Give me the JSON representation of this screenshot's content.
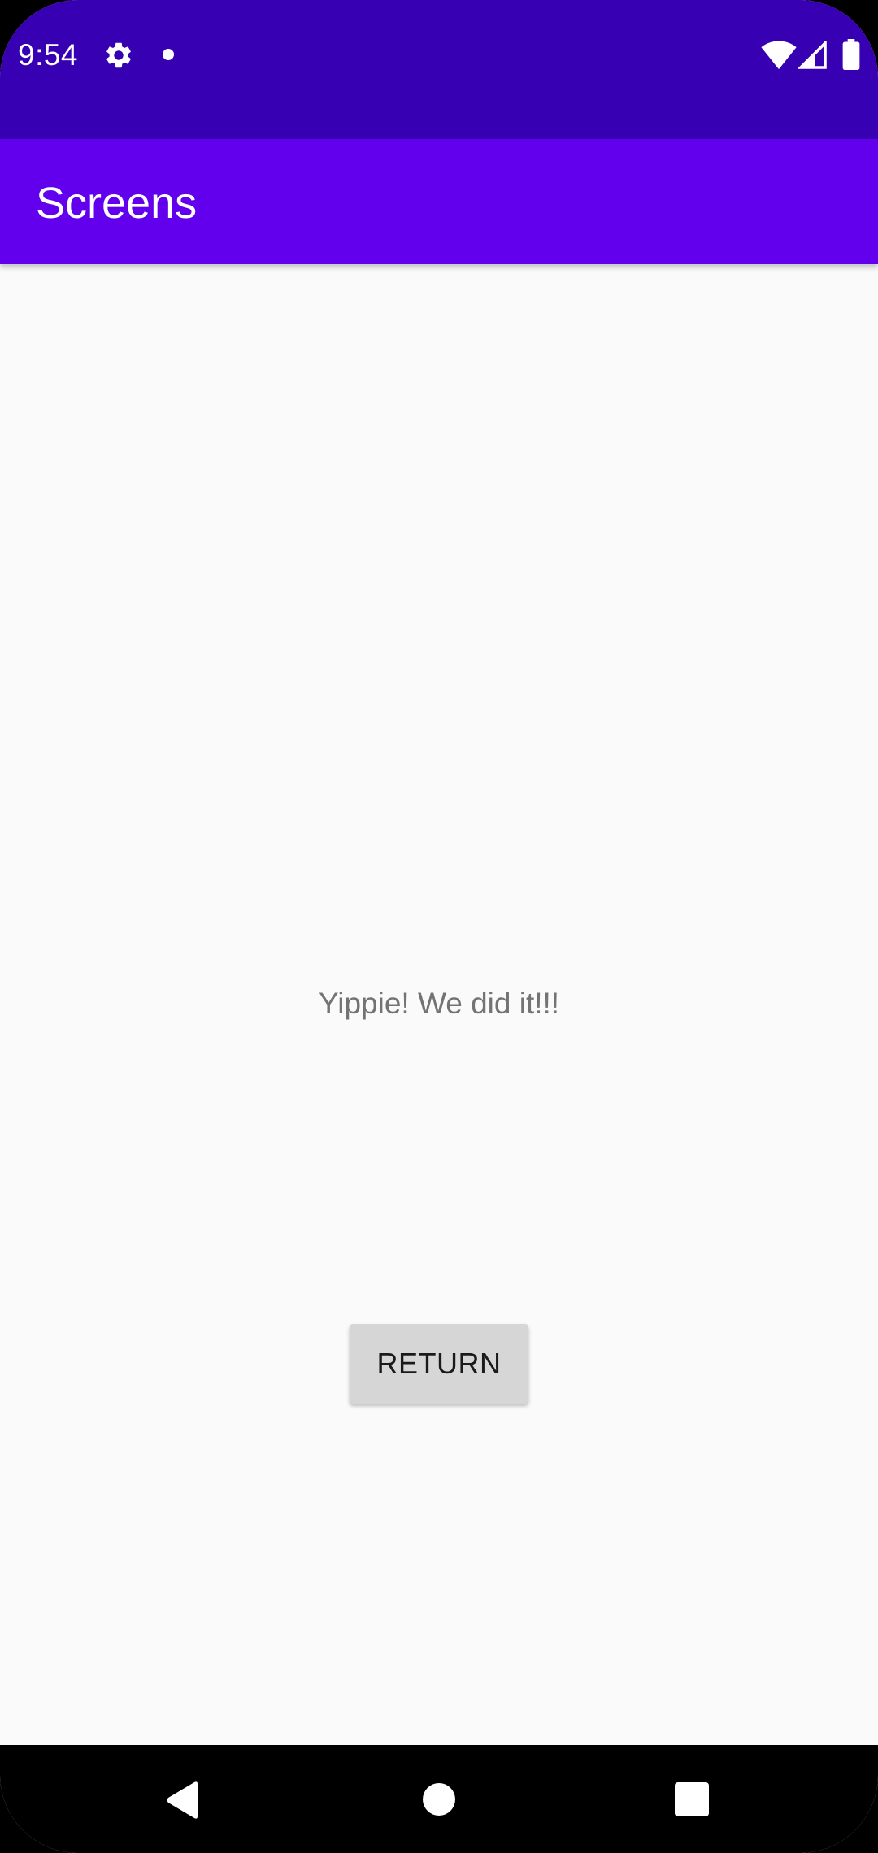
{
  "status_bar": {
    "time": "9:54",
    "icons": [
      "gear-icon",
      "notification-dot-icon",
      "wifi-icon",
      "signal-icon",
      "battery-icon"
    ],
    "background_color": "#3700b3"
  },
  "app_bar": {
    "title": "Screens",
    "background_color": "#6200ee"
  },
  "main": {
    "message": "Yippie! We did it!!!",
    "return_button_label": "RETURN"
  },
  "nav_bar": {
    "icons": [
      "back-icon",
      "home-icon",
      "recents-icon"
    ]
  }
}
